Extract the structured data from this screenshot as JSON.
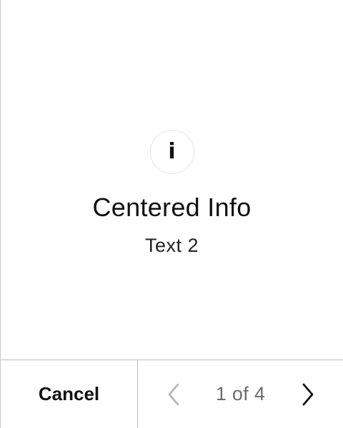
{
  "info": {
    "icon_glyph": "i",
    "title": "Centered Info",
    "text": "Text 2"
  },
  "footer": {
    "cancel_label": "Cancel",
    "page_indicator": "1 of 4",
    "prev_icon": "chevron-left-icon",
    "next_icon": "chevron-right-icon"
  },
  "pagination": {
    "current_page": 1,
    "total_pages": 4,
    "prev_enabled": false,
    "next_enabled": true
  },
  "colors": {
    "disabled_chevron": "#b5b5b5",
    "enabled_chevron": "#111111",
    "divider": "#bdbdbd"
  }
}
